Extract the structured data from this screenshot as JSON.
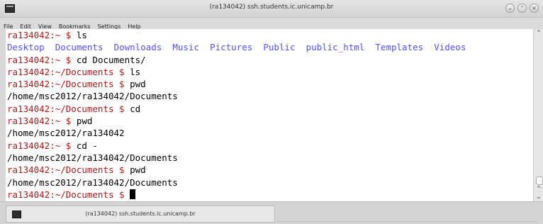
{
  "window": {
    "title": "(ra134042) ssh.students.ic.unicamp.br",
    "controls": {
      "minimize": "⌄",
      "maximize": "⌃",
      "close": "×"
    }
  },
  "menu": [
    "File",
    "Edit",
    "View",
    "Bookmarks",
    "Settings",
    "Help"
  ],
  "terminal": {
    "lines": [
      {
        "type": "prompt",
        "prompt": "ra134042:~ $ ",
        "command": "ls"
      },
      {
        "type": "dirs",
        "items": [
          "Desktop",
          "Documents",
          "Downloads",
          "Music",
          "Pictures",
          "Public",
          "public_html",
          "Templates",
          "Videos"
        ]
      },
      {
        "type": "prompt",
        "prompt": "ra134042:~ $ ",
        "command": "cd Documents/"
      },
      {
        "type": "prompt",
        "prompt": "ra134042:~/Documents $ ",
        "command": "ls"
      },
      {
        "type": "prompt",
        "prompt": "ra134042:~/Documents $ ",
        "command": "pwd"
      },
      {
        "type": "output",
        "text": "/home/msc2012/ra134042/Documents"
      },
      {
        "type": "prompt",
        "prompt": "ra134042:~/Documents $ ",
        "command": "cd"
      },
      {
        "type": "prompt",
        "prompt": "ra134042:~ $ ",
        "command": "pwd"
      },
      {
        "type": "output",
        "text": "/home/msc2012/ra134042"
      },
      {
        "type": "prompt",
        "prompt": "ra134042:~ $ ",
        "command": "cd -"
      },
      {
        "type": "output",
        "text": "/home/msc2012/ra134042/Documents"
      },
      {
        "type": "prompt",
        "prompt": "ra134042:~/Documents $ ",
        "command": "pwd"
      },
      {
        "type": "output",
        "text": "/home/msc2012/ra134042/Documents"
      },
      {
        "type": "prompt",
        "prompt": "ra134042:~/Documents $ ",
        "command": "",
        "cursor": true
      }
    ]
  },
  "tab": {
    "label": "(ra134042) ssh.students.ic.unicamp.br"
  },
  "colors": {
    "prompt": "#b21818",
    "directory": "#5353ff",
    "text": "#000000",
    "background": "#ffffff"
  }
}
